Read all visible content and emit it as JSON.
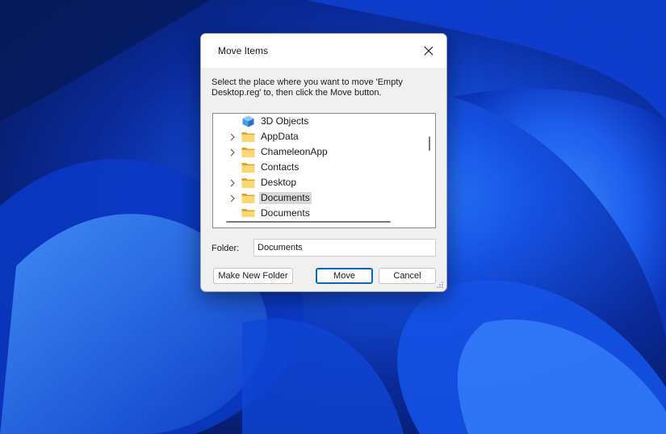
{
  "dialog": {
    "title": "Move Items",
    "instruction": "Select the place where you want to move 'Empty Desktop.reg' to, then click the Move button.",
    "tree": [
      {
        "label": "3D Objects",
        "icon": "3d-objects-icon",
        "expandable": false,
        "selected": false
      },
      {
        "label": "AppData",
        "icon": "folder-icon",
        "expandable": true,
        "selected": false
      },
      {
        "label": "ChameleonApp",
        "icon": "folder-icon",
        "expandable": true,
        "selected": false
      },
      {
        "label": "Contacts",
        "icon": "folder-icon",
        "expandable": false,
        "selected": false
      },
      {
        "label": "Desktop",
        "icon": "folder-icon",
        "expandable": true,
        "selected": false
      },
      {
        "label": "Documents",
        "icon": "folder-icon",
        "expandable": true,
        "selected": true
      },
      {
        "label": "Documents",
        "icon": "folder-icon",
        "expandable": false,
        "selected": false
      }
    ],
    "folder_label": "Folder:",
    "folder_value": "Documents",
    "buttons": {
      "new_folder": "Make New Folder",
      "move": "Move",
      "cancel": "Cancel"
    }
  },
  "colors": {
    "folder": "#f5c242",
    "folder_dark": "#e0a52a",
    "accent": "#0067c0",
    "selection": "#d9d9d9"
  }
}
